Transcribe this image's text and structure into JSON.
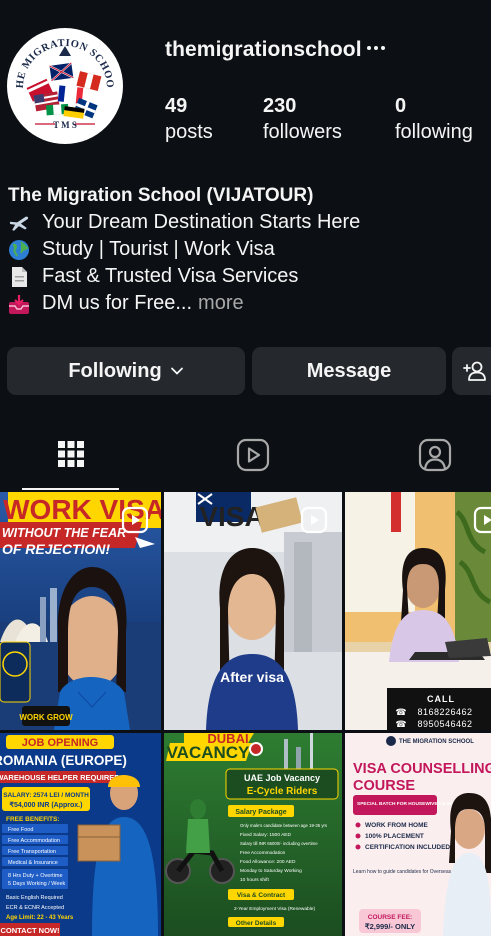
{
  "profile": {
    "username": "themigrationschool",
    "logo_text": "THE MIGRATION SCHOOL",
    "logo_sub": "T M S",
    "stats": [
      {
        "value": "49",
        "label": "posts"
      },
      {
        "value": "230",
        "label": "followers"
      },
      {
        "value": "0",
        "label": "following"
      }
    ]
  },
  "bio": {
    "name": "The Migration School (VIJATOUR)",
    "lines": [
      {
        "icon": "airplane-icon",
        "text": "Your Dream Destination Starts Here"
      },
      {
        "icon": "globe-icon",
        "text": "Study | Tourist | Work Visa"
      },
      {
        "icon": "document-icon",
        "text": "Fast & Trusted Visa Services"
      },
      {
        "icon": "inbox-icon",
        "text": "DM us for Free..."
      }
    ],
    "more": "more"
  },
  "actions": {
    "following": "Following",
    "message": "Message"
  },
  "tabs": [
    "posts-grid",
    "reels",
    "tagged"
  ],
  "posts": [
    {
      "type": "reel",
      "headline": "WORK VISA",
      "sub": "WITHOUT THE FEAR",
      "sub2": "OF REJECTION!",
      "badge": "WORK GROW"
    },
    {
      "type": "reel",
      "headline": "VISA",
      "caption": "After visa"
    },
    {
      "type": "reel",
      "call_label": "CALL",
      "phone1": "8168226462",
      "phone2": "8950546462"
    },
    {
      "type": "post",
      "headline": "JOB OPENING",
      "country": "ROMANIA (EUROPE)",
      "role": "WAREHOUSE HELPER REQUIRED",
      "salary": "SALARY: 2574 LEI / MONTH",
      "salary_inr": "₹54,000 INR (Approx.)",
      "benefits_title": "FREE BENEFITS:",
      "benefits": [
        "Free Food",
        "Free Accommodation",
        "Free Transportation",
        "Medical & Insurance"
      ],
      "duty": "8 Hrs Duty + Overtime",
      "days": "5 Days Working / Week",
      "english": "Basic English Required",
      "ecr": "ECR & ECNR Accepted",
      "age": "Age Limit: 22 - 43 Years",
      "contact": "CONTACT NOW!"
    },
    {
      "type": "post",
      "headline": "DUBAI",
      "headline2": "VACANCY",
      "title1": "UAE Job Vacancy",
      "title2": "E-Cycle Riders",
      "package_title": "Salary Package",
      "package": [
        "Only male's candidate between age 19-35 yrs",
        "Fixed Salary: 1500 AED",
        "Salary till INR 65000/- including overtime",
        "Free Accommodation",
        "Food Allowance: 200 AED",
        "Monday to Saturday Working",
        "10 hours shift"
      ],
      "visa_title": "Visa & Contract",
      "visa": "2-Year Employment Visa (Renewable)",
      "other": "Other Details"
    },
    {
      "type": "post",
      "brand": "THE MIGRATION SCHOOL",
      "headline": "VISA COUNSELLING",
      "headline2": "COURSE",
      "special": "SPECIAL BATCH FOR HOUSEWIVES & WOMEN",
      "points": [
        "WORK FROM HOME",
        "100% PLACEMENT",
        "CERTIFICATION INCLUDED"
      ],
      "learn": "Learn how to guide candidates for Overseas Jobs & Study Visas",
      "fee_label": "COURSE FEE:",
      "fee": "₹2,999/- ONLY"
    }
  ],
  "colors": {
    "background": "#0c1014",
    "button": "#25292e",
    "muted": "#a8a8a8"
  }
}
